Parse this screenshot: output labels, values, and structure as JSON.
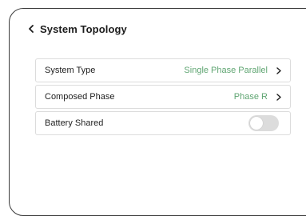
{
  "header": {
    "title": "System Topology",
    "back_icon": "chevron-left-icon"
  },
  "settings": [
    {
      "label": "System Type",
      "value": "Single Phase Parallel",
      "control": "chevron-right-icon"
    },
    {
      "label": "Composed Phase",
      "value": "Phase R",
      "control": "chevron-right-icon"
    },
    {
      "label": "Battery Shared",
      "toggle_on": false,
      "control": "toggle"
    }
  ],
  "colors": {
    "value_text": "#5fa572",
    "toggle_off": "#dcdcdc",
    "border": "#dcdcdc"
  }
}
